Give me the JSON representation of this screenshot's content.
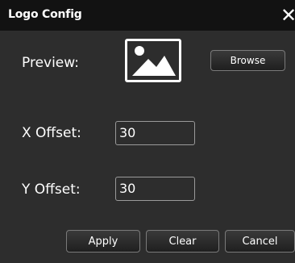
{
  "dialog": {
    "title": "Logo Config",
    "close_glyph": "✕"
  },
  "preview": {
    "label": "Preview:",
    "icon": "image-icon",
    "browse_label": "Browse"
  },
  "offsets": {
    "x_label": "X Offset:",
    "x_value": "30",
    "y_label": "Y Offset:",
    "y_value": "30"
  },
  "footer": {
    "apply_label": "Apply",
    "clear_label": "Clear",
    "cancel_label": "Cancel"
  },
  "colors": {
    "background": "#2d2d2d",
    "titlebar": "#121212",
    "text": "#ffffff",
    "field_border": "#9a9a9a"
  }
}
